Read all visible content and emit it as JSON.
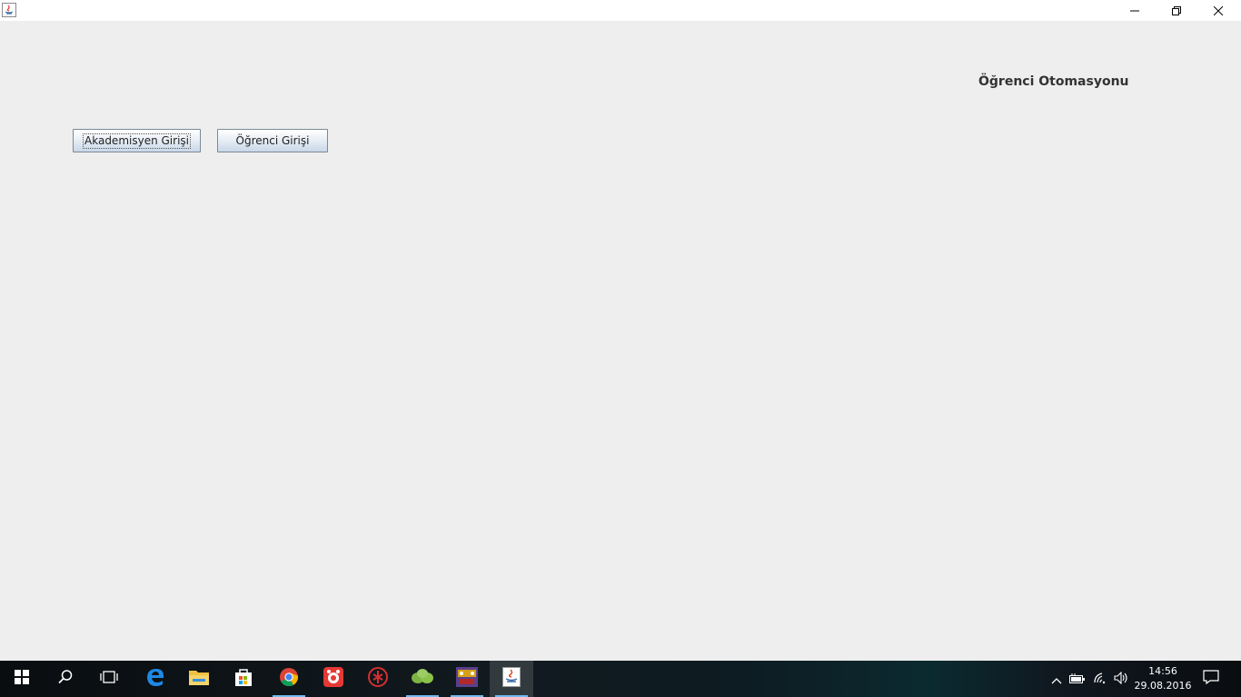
{
  "window": {
    "app_icon": "java-icon",
    "controls": [
      "minimize-icon",
      "maximize-icon",
      "close-icon"
    ]
  },
  "main": {
    "title": "Öğrenci Otomasyonu",
    "buttons": {
      "akademisyen": "Akademisyen Girişi",
      "ogrenci": "Öğrenci Girişi"
    }
  },
  "taskbar": {
    "apps": [
      "start-icon",
      "search-icon",
      "task-view-icon",
      "edge-icon",
      "file-explorer-icon",
      "store-icon",
      "chrome-icon",
      "app-red-icon",
      "app-dark-red-icon",
      "app-green-icon",
      "app-game-icon",
      "java-icon"
    ],
    "clock": {
      "time": "14:56",
      "date": "29.08.2016"
    }
  },
  "colors": {
    "content_bg": "#eeeeee",
    "taskbar_bg": "#0a0d10",
    "running_indicator": "#76b9ed"
  }
}
